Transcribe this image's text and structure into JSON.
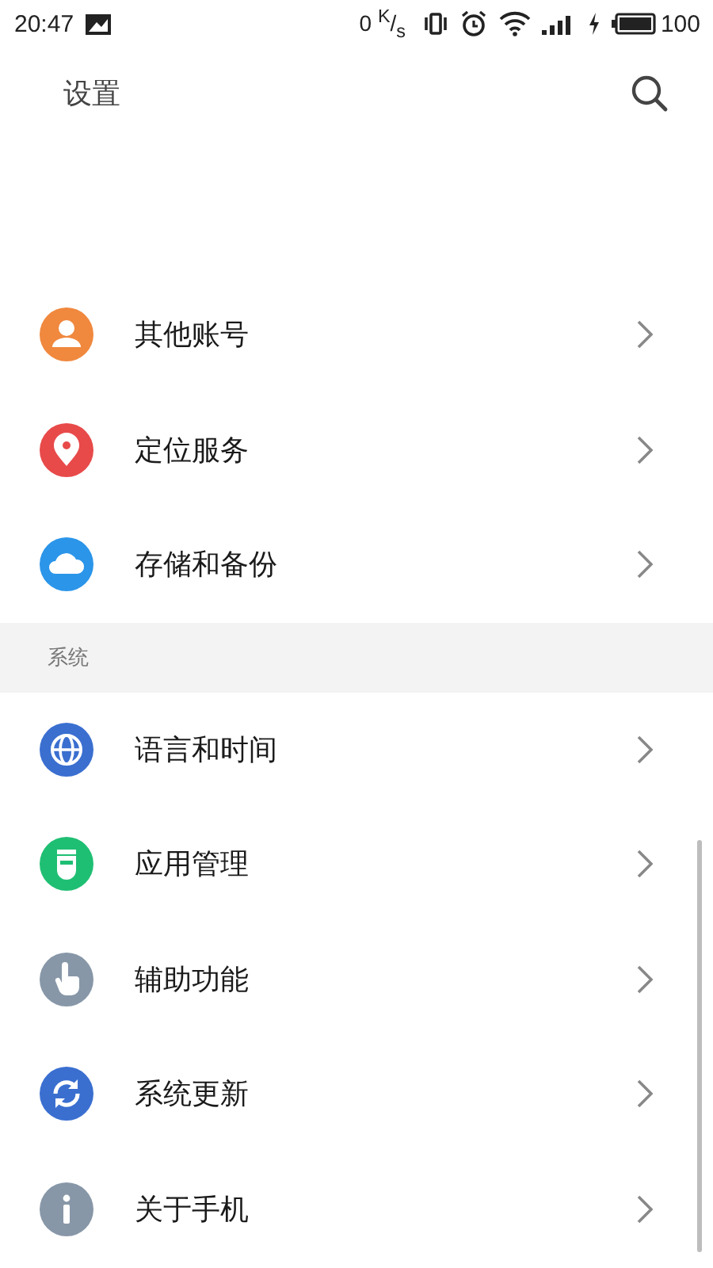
{
  "status_bar": {
    "time": "20:47",
    "net_speed": "0 $^{K}$/$_{s}$",
    "battery": "100"
  },
  "header": {
    "title": "设置"
  },
  "groups": [
    {
      "items": [
        {
          "label": "其他账号",
          "color": "#f0883e"
        },
        {
          "label": "定位服务",
          "color": "#e84a4a"
        },
        {
          "label": "存储和备份",
          "color": "#2b95e9"
        }
      ]
    },
    {
      "title": "系统",
      "items": [
        {
          "label": "语言和时间",
          "color": "#3a6fd0"
        },
        {
          "label": "应用管理",
          "color": "#1fbf73"
        },
        {
          "label": "辅助功能",
          "color": "#8797a8"
        },
        {
          "label": "系统更新",
          "color": "#3a6fd0"
        },
        {
          "label": "关于手机",
          "color": "#8797a8"
        }
      ]
    }
  ]
}
